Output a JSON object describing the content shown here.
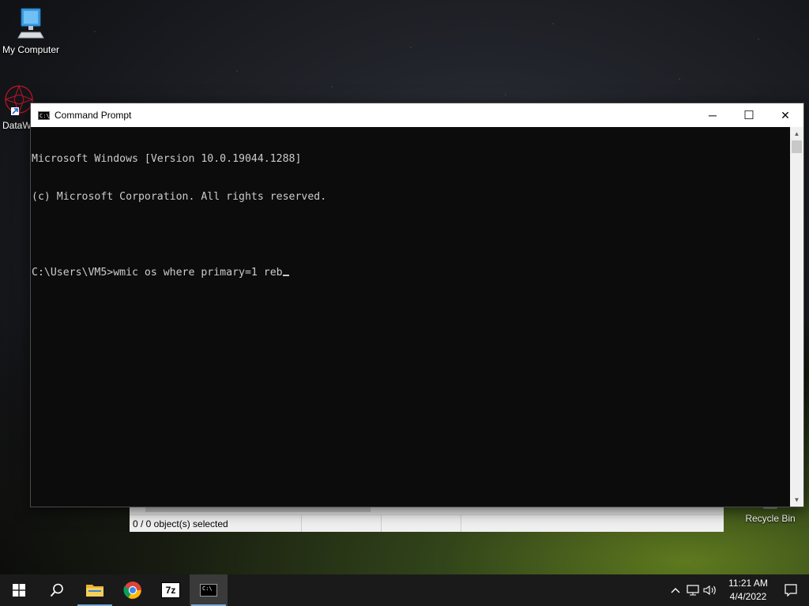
{
  "desktop": {
    "icons": [
      {
        "label": "My Computer"
      },
      {
        "label": "DataW"
      },
      {
        "label": "Recycle Bin"
      }
    ]
  },
  "cmd_window": {
    "title": "Command Prompt",
    "icon_text": "C:\\",
    "buttons": {
      "minimize": "─",
      "maximize": "☐",
      "close": "✕"
    },
    "lines": [
      "Microsoft Windows [Version 10.0.19044.1288]",
      "(c) Microsoft Corporation. All rights reserved.",
      "",
      "C:\\Users\\VM5>wmic os where primary=1 reb"
    ]
  },
  "explorer": {
    "status_text": "0 / 0 object(s) selected"
  },
  "taskbar": {
    "apps": [
      "start",
      "search",
      "file-explorer",
      "chrome",
      "7-zip",
      "command-prompt"
    ],
    "sevenzip_label": "7z",
    "clock": {
      "time": "11:21 AM",
      "date": "4/4/2022"
    }
  }
}
